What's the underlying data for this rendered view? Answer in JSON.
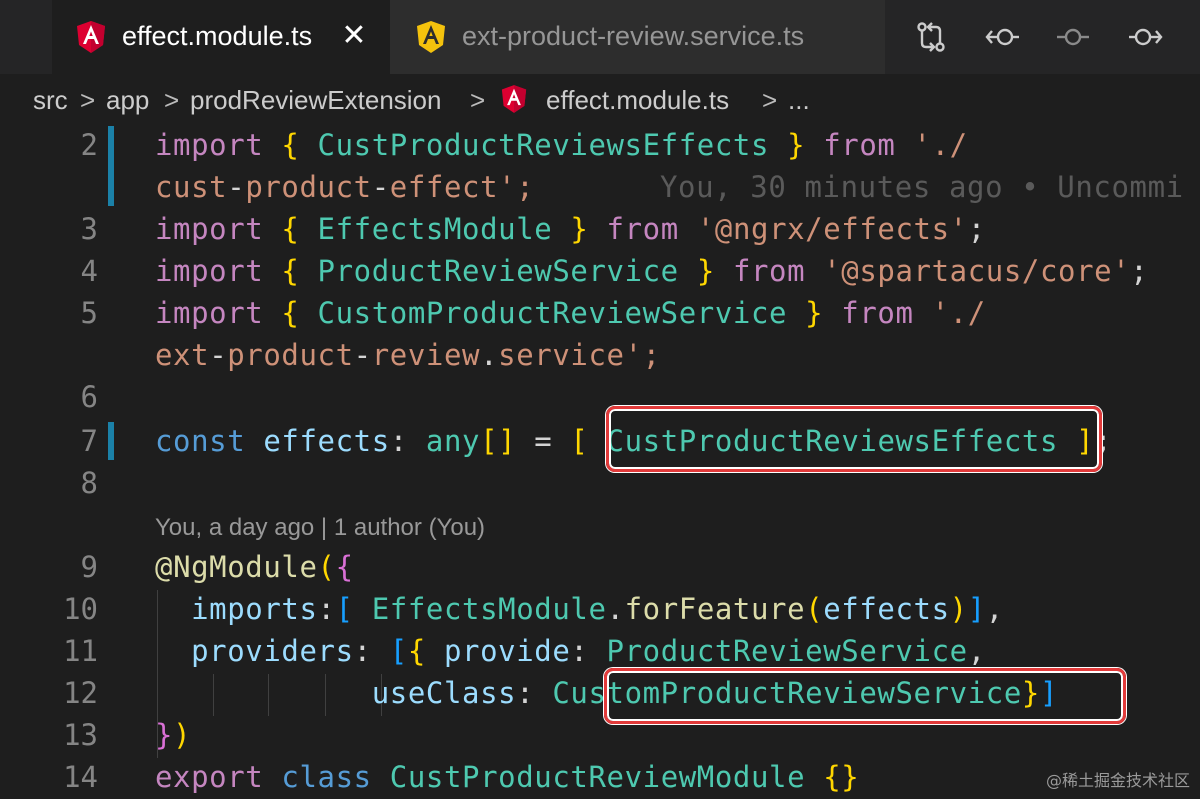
{
  "tabs": [
    {
      "label": "effect.module.ts",
      "active": true,
      "icon": "angular-icon",
      "icon_color": "#dd0031"
    },
    {
      "label": "ext-product-review.service.ts",
      "active": false,
      "icon": "angular-service-icon",
      "icon_color": "#f4c20d"
    }
  ],
  "tab_close_glyph": "✕",
  "actions": [
    "git-compare-icon",
    "go-back-icon",
    "commit-icon",
    "go-forward-icon"
  ],
  "breadcrumb": {
    "items": [
      "src",
      "app",
      "prodReviewExtension",
      "effect.module.ts",
      "..."
    ],
    "separator": ">"
  },
  "editor": {
    "codelens": "You, a day ago | 1 author (You)",
    "blame": "You, 30 minutes ago • Uncommi",
    "lines": [
      {
        "n": "2",
        "text": "import { CustProductReviewsEffects } from './"
      },
      {
        "n": "",
        "text": "cust-product-effect';"
      },
      {
        "n": "3",
        "text": "import { EffectsModule } from '@ngrx/effects';"
      },
      {
        "n": "4",
        "text": "import { ProductReviewService } from '@spartacus/core';"
      },
      {
        "n": "5",
        "text": "import { CustomProductReviewService } from './"
      },
      {
        "n": "",
        "text": "ext-product-review.service';"
      },
      {
        "n": "6",
        "text": ""
      },
      {
        "n": "7",
        "text": "const effects: any[] = [ CustProductReviewsEffects ];"
      },
      {
        "n": "8",
        "text": ""
      },
      {
        "n": "9",
        "text": "@NgModule({"
      },
      {
        "n": "10",
        "text": "  imports:[ EffectsModule.forFeature(effects)],"
      },
      {
        "n": "11",
        "text": "  providers: [{ provide: ProductReviewService,"
      },
      {
        "n": "12",
        "text": "            useClass: CustomProductReviewService}]"
      },
      {
        "n": "13",
        "text": "})"
      },
      {
        "n": "14",
        "text": "export class CustProductReviewModule {}"
      }
    ]
  },
  "watermark": "@稀土掘金技术社区",
  "colors": {
    "keyword": "#569cd6",
    "control_keyword": "#c586c0",
    "class_name": "#4ec9b0",
    "string": "#ce9178",
    "variable": "#9cdcfe",
    "function": "#dcdcaa",
    "highlight_box": "#e23a3a",
    "gutter_modified": "#1b81a8"
  }
}
